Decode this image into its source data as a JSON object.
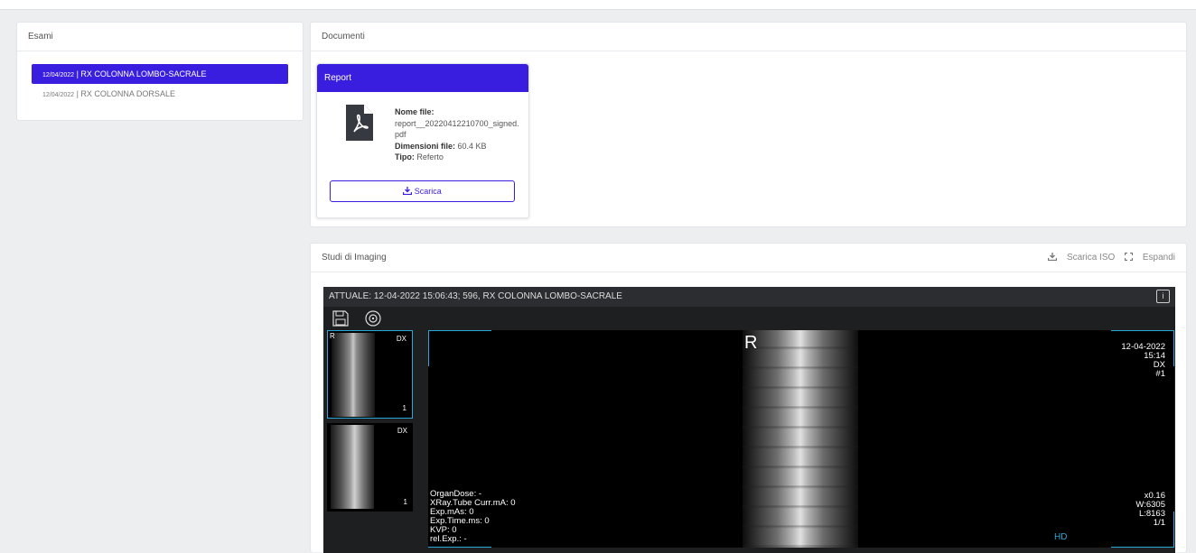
{
  "colors": {
    "accent": "#3a1ee0",
    "viewer_highlight": "#2aa8d8",
    "viewer_bg": "#1e1f21"
  },
  "esami": {
    "title": "Esami",
    "items": [
      {
        "date": "12/04/2022",
        "separator": "|",
        "label": "RX COLONNA LOMBO-SACRALE",
        "active": true
      },
      {
        "date": "12/04/2022",
        "separator": "|",
        "label": "RX COLONNA DORSALE",
        "active": false
      }
    ]
  },
  "documenti": {
    "title": "Documenti",
    "report": {
      "header": "Report",
      "icon": "file-pdf-icon",
      "file_name_label": "Nome file:",
      "file_name": "report__20220412210700_signed.pdf",
      "size_label": "Dimensioni file:",
      "size": "60.4 KB",
      "type_label": "Tipo:",
      "type": "Referto",
      "download_label": "Scarica"
    }
  },
  "imaging": {
    "title": "Studi di Imaging",
    "download_iso_label": "Scarica ISO",
    "expand_label": "Espandi",
    "viewer": {
      "header": "ATTUALE: 12-04-2022 15:06:43; 596, RX COLONNA LOMBO-SACRALE",
      "info_icon_text": "i",
      "thumbnails": [
        {
          "left_mark": "R",
          "view": "DX",
          "count": "1"
        },
        {
          "view": "DX",
          "count": "1"
        }
      ],
      "main_mark": "R",
      "top_right": [
        "12-04-2022",
        "15:14",
        "DX",
        "#1"
      ],
      "bottom_left": [
        "OrganDose: -",
        "XRay.Tube Curr.mA: 0",
        "Exp.mAs: 0",
        "Exp.Time.ms: 0",
        "KVP: 0",
        "rel.Exp.: -"
      ],
      "bottom_right": [
        "x0.16",
        "W:6305",
        "L:8163",
        "1/1"
      ],
      "hd": "HD"
    }
  }
}
